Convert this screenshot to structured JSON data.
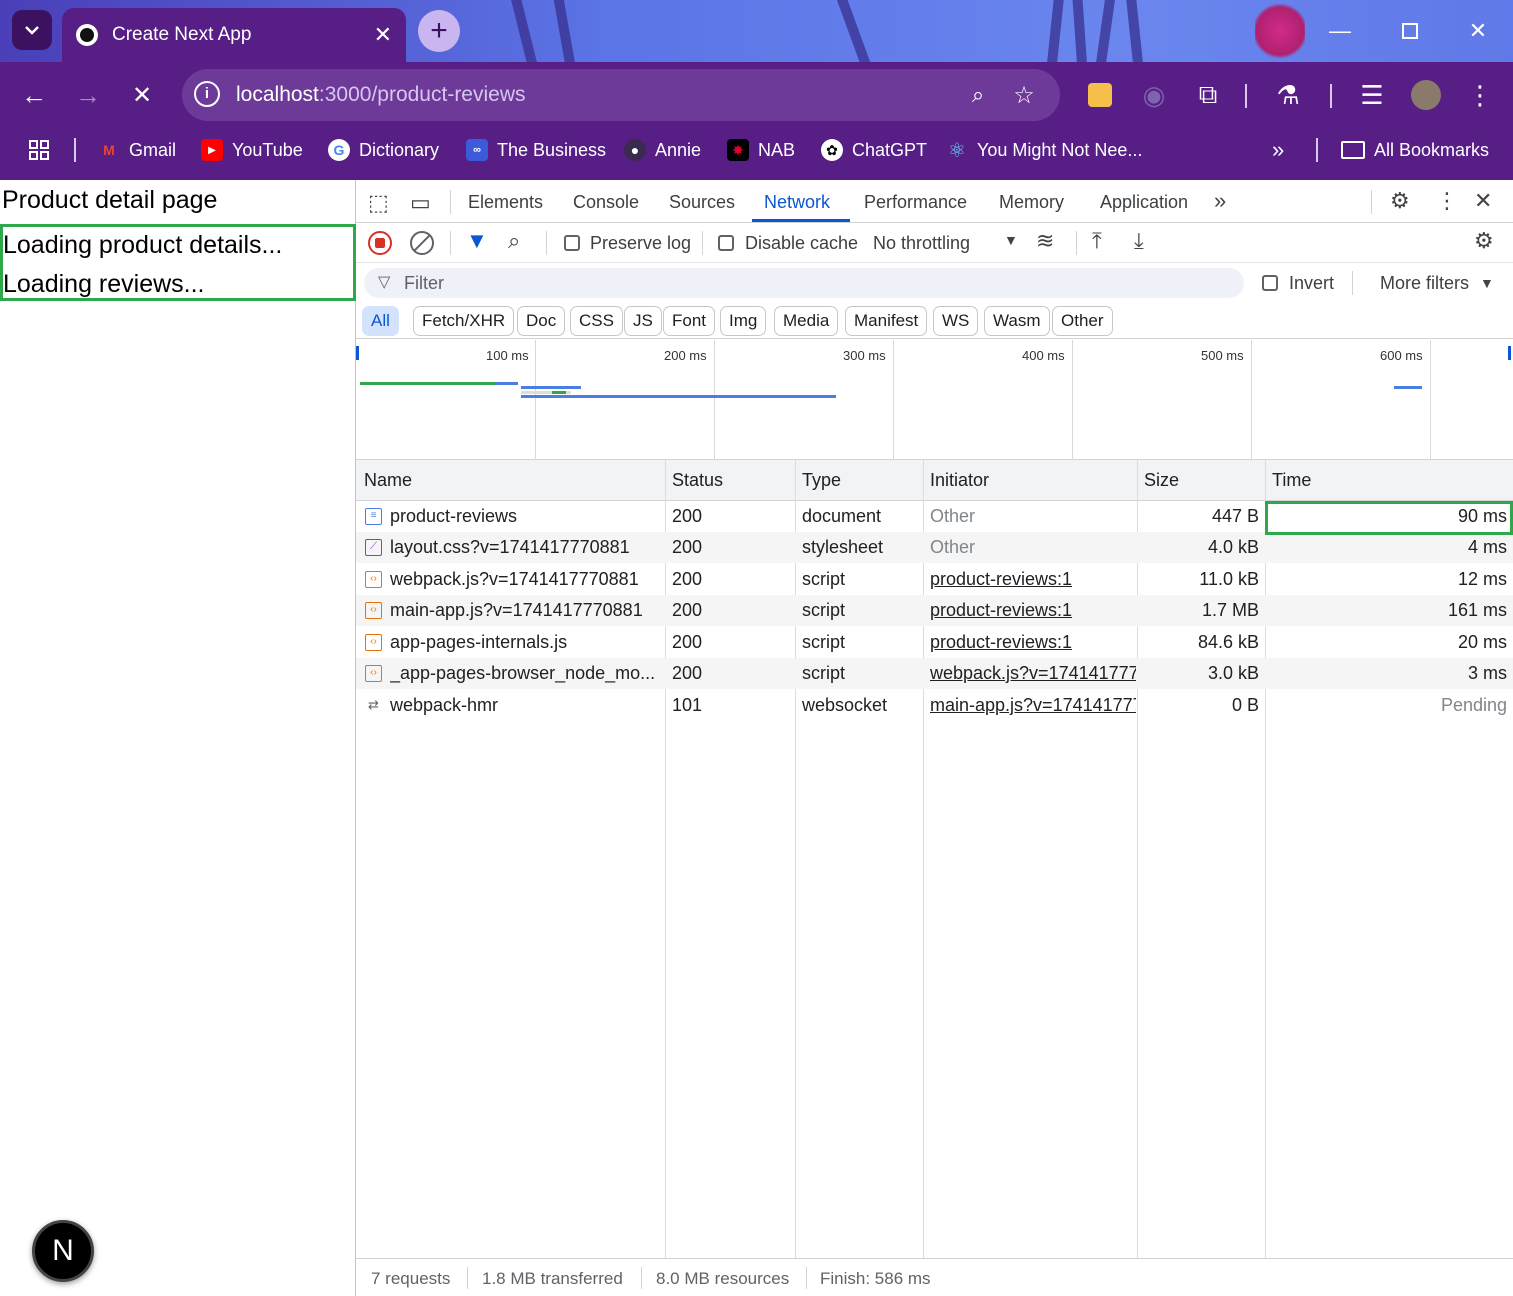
{
  "browser": {
    "tab": {
      "title": "Create Next App"
    },
    "url": {
      "host": "localhost",
      "rest": ":3000/product-reviews"
    },
    "bookmarks": [
      {
        "label": "Gmail",
        "icon": "gmail-icon"
      },
      {
        "label": "YouTube",
        "icon": "youtube-icon"
      },
      {
        "label": "Dictionary",
        "icon": "google-icon"
      },
      {
        "label": "The Business",
        "icon": "abc-icon"
      },
      {
        "label": "Annie",
        "icon": "github-icon"
      },
      {
        "label": "NAB",
        "icon": "nab-icon"
      },
      {
        "label": "ChatGPT",
        "icon": "openai-icon"
      },
      {
        "label": "You Might Not Nee...",
        "icon": "react-icon"
      }
    ],
    "all_bookmarks": "All Bookmarks"
  },
  "page": {
    "title": "Product detail page",
    "loading_details": "Loading product details...",
    "loading_reviews": "Loading reviews...",
    "badge": "N"
  },
  "devtools": {
    "tabs": [
      "Elements",
      "Console",
      "Sources",
      "Network",
      "Performance",
      "Memory",
      "Application"
    ],
    "active_tab": "Network",
    "toolbar": {
      "preserve_log": "Preserve log",
      "disable_cache": "Disable cache",
      "throttling": "No throttling"
    },
    "filter": {
      "placeholder": "Filter",
      "invert": "Invert",
      "more_filters": "More filters"
    },
    "type_filters": [
      "All",
      "Fetch/XHR",
      "Doc",
      "CSS",
      "JS",
      "Font",
      "Img",
      "Media",
      "Manifest",
      "WS",
      "Wasm",
      "Other"
    ],
    "timeline_labels": [
      "100 ms",
      "200 ms",
      "300 ms",
      "400 ms",
      "500 ms",
      "600 ms"
    ],
    "columns": [
      "Name",
      "Status",
      "Type",
      "Initiator",
      "Size",
      "Time"
    ],
    "requests": [
      {
        "name": "product-reviews",
        "status": "200",
        "type": "document",
        "initiator": "Other",
        "size": "447 B",
        "time": "90 ms"
      },
      {
        "name": "layout.css?v=1741417770881",
        "status": "200",
        "type": "stylesheet",
        "initiator": "Other",
        "size": "4.0 kB",
        "time": "4 ms"
      },
      {
        "name": "webpack.js?v=1741417770881",
        "status": "200",
        "type": "script",
        "initiator": "product-reviews:1",
        "size": "11.0 kB",
        "time": "12 ms"
      },
      {
        "name": "main-app.js?v=1741417770881",
        "status": "200",
        "type": "script",
        "initiator": "product-reviews:1",
        "size": "1.7 MB",
        "time": "161 ms"
      },
      {
        "name": "app-pages-internals.js",
        "status": "200",
        "type": "script",
        "initiator": "product-reviews:1",
        "size": "84.6 kB",
        "time": "20 ms"
      },
      {
        "name": "_app-pages-browser_node_mo...",
        "status": "200",
        "type": "script",
        "initiator": "webpack.js?v=174141777(",
        "size": "3.0 kB",
        "time": "3 ms"
      },
      {
        "name": "webpack-hmr",
        "status": "101",
        "type": "websocket",
        "initiator": "main-app.js?v=174141777",
        "size": "0 B",
        "time": "Pending"
      }
    ],
    "status": {
      "requests": "7 requests",
      "transferred": "1.8 MB transferred",
      "resources": "8.0 MB resources",
      "finish": "Finish: 586 ms"
    }
  },
  "colors": {
    "accent": "#0b57d0",
    "highlight": "#2ea84a",
    "browser_frame": "#571e86"
  }
}
